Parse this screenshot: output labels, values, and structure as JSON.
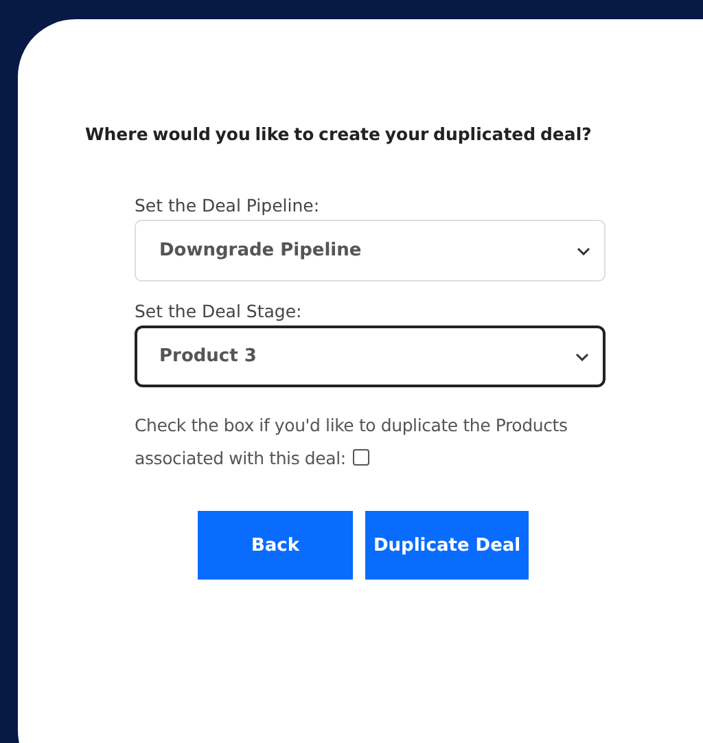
{
  "dialog": {
    "question": "Where would you like to create your duplicated deal?",
    "fields": [
      {
        "label": "Set the Deal Pipeline:",
        "value": "Downgrade Pipeline",
        "focused": false
      },
      {
        "label": "Set the Deal Stage:",
        "value": "Product 3",
        "focused": true
      }
    ],
    "checkbox": {
      "label": "Check the box if you'd like to duplicate the Products associated with this deal:",
      "checked": false
    },
    "buttons": [
      "Back",
      "Duplicate Deal"
    ]
  }
}
